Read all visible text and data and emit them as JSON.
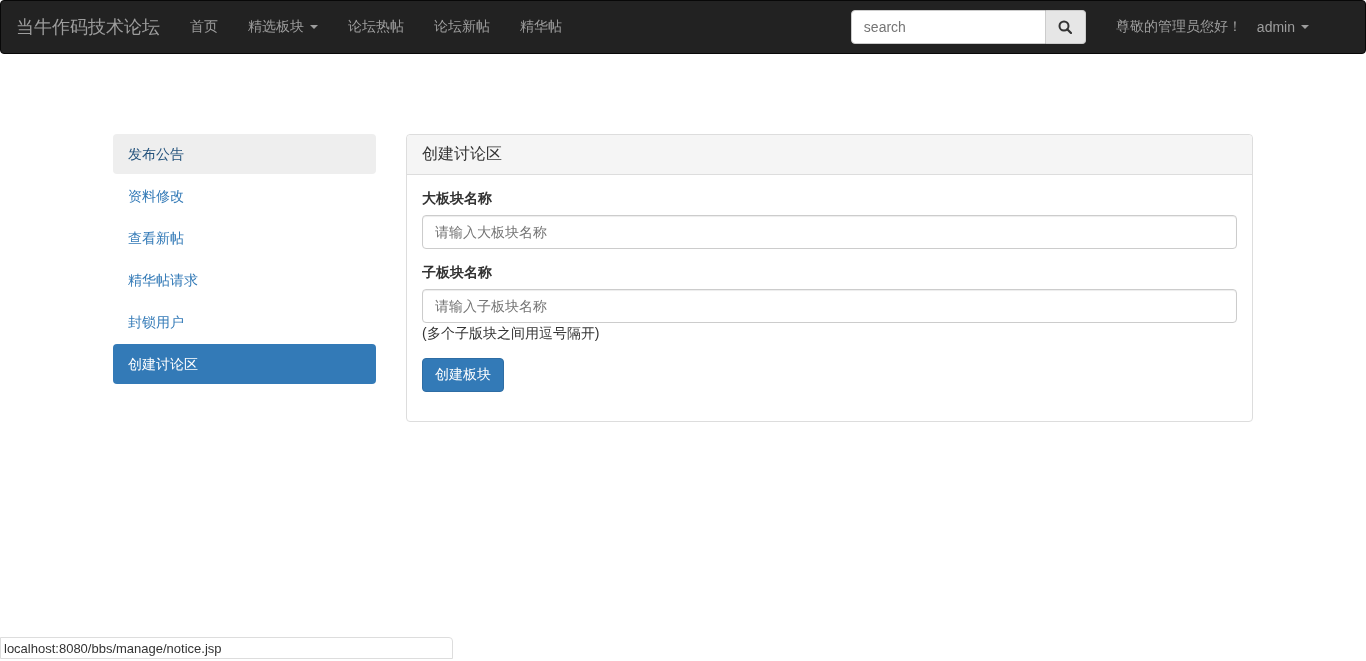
{
  "navbar": {
    "brand": "当牛作码技术论坛",
    "links": [
      {
        "label": "首页",
        "dropdown": false
      },
      {
        "label": "精选板块",
        "dropdown": true
      },
      {
        "label": "论坛热帖",
        "dropdown": false
      },
      {
        "label": "论坛新帖",
        "dropdown": false
      },
      {
        "label": "精华帖",
        "dropdown": false
      }
    ],
    "search": {
      "placeholder": "search"
    },
    "greeting": "尊敬的管理员您好！",
    "user": {
      "label": "admin",
      "dropdown": true
    }
  },
  "sidebar": {
    "items": [
      {
        "label": "发布公告",
        "selected": false,
        "hovered": true
      },
      {
        "label": "资料修改",
        "selected": false,
        "hovered": false
      },
      {
        "label": "查看新帖",
        "selected": false,
        "hovered": false
      },
      {
        "label": "精华帖请求",
        "selected": false,
        "hovered": false
      },
      {
        "label": "封锁用户",
        "selected": false,
        "hovered": false
      },
      {
        "label": "创建讨论区",
        "selected": true,
        "hovered": false
      }
    ]
  },
  "panel": {
    "title": "创建讨论区",
    "fields": [
      {
        "label": "大板块名称",
        "placeholder": "请输入大板块名称"
      },
      {
        "label": "子板块名称",
        "placeholder": "请输入子板块名称",
        "help": "(多个子版块之间用逗号隔开)"
      }
    ],
    "button": "创建板块"
  },
  "status_bar": {
    "url": "localhost:8080/bbs/manage/notice.jsp"
  }
}
